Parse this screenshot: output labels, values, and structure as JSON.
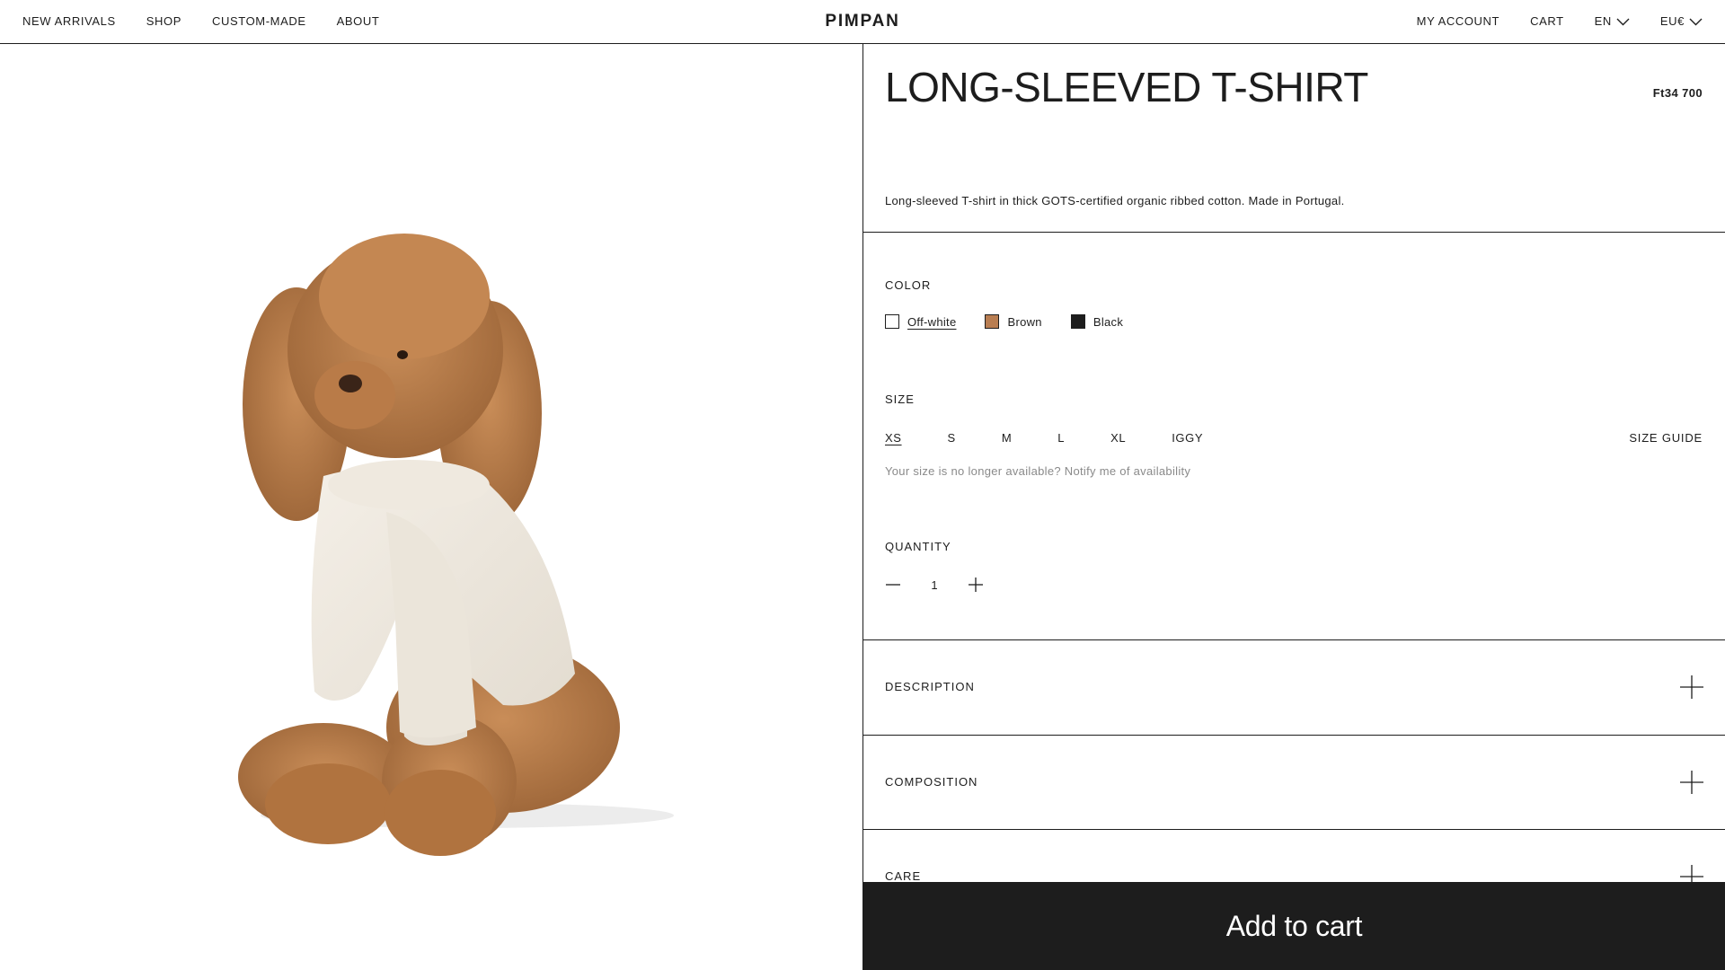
{
  "header": {
    "nav_left": [
      "NEW ARRIVALS",
      "SHOP",
      "CUSTOM-MADE",
      "ABOUT"
    ],
    "logo": "PIMPAN",
    "my_account": "MY ACCOUNT",
    "cart": "CART",
    "language": "EN",
    "currency": "EU€"
  },
  "product": {
    "title": "LONG-SLEEVED T-SHIRT",
    "price": "Ft34 700",
    "short_description": "Long-sleeved T-shirt in thick GOTS-certified organic ribbed cotton. Made in Portugal."
  },
  "color": {
    "label": "COLOR",
    "options": [
      {
        "name": "Off-white",
        "hex": "#ffffff",
        "selected": true
      },
      {
        "name": "Brown",
        "hex": "#b97e52",
        "selected": false
      },
      {
        "name": "Black",
        "hex": "#1d1d1d",
        "selected": false
      }
    ]
  },
  "size": {
    "label": "SIZE",
    "options": [
      "XS",
      "S",
      "M",
      "L",
      "XL",
      "IGGY"
    ],
    "selected": "XS",
    "guide": "SIZE GUIDE",
    "notify": "Your size is no longer available? Notify me of availability"
  },
  "quantity": {
    "label": "QUANTITY",
    "value": "1"
  },
  "accordion": [
    "DESCRIPTION",
    "COMPOSITION",
    "CARE"
  ],
  "add_to_cart": "Add to cart",
  "colors": {
    "ink": "#1d1d1d",
    "muted": "#8a8a8a",
    "background": "#ffffff"
  }
}
